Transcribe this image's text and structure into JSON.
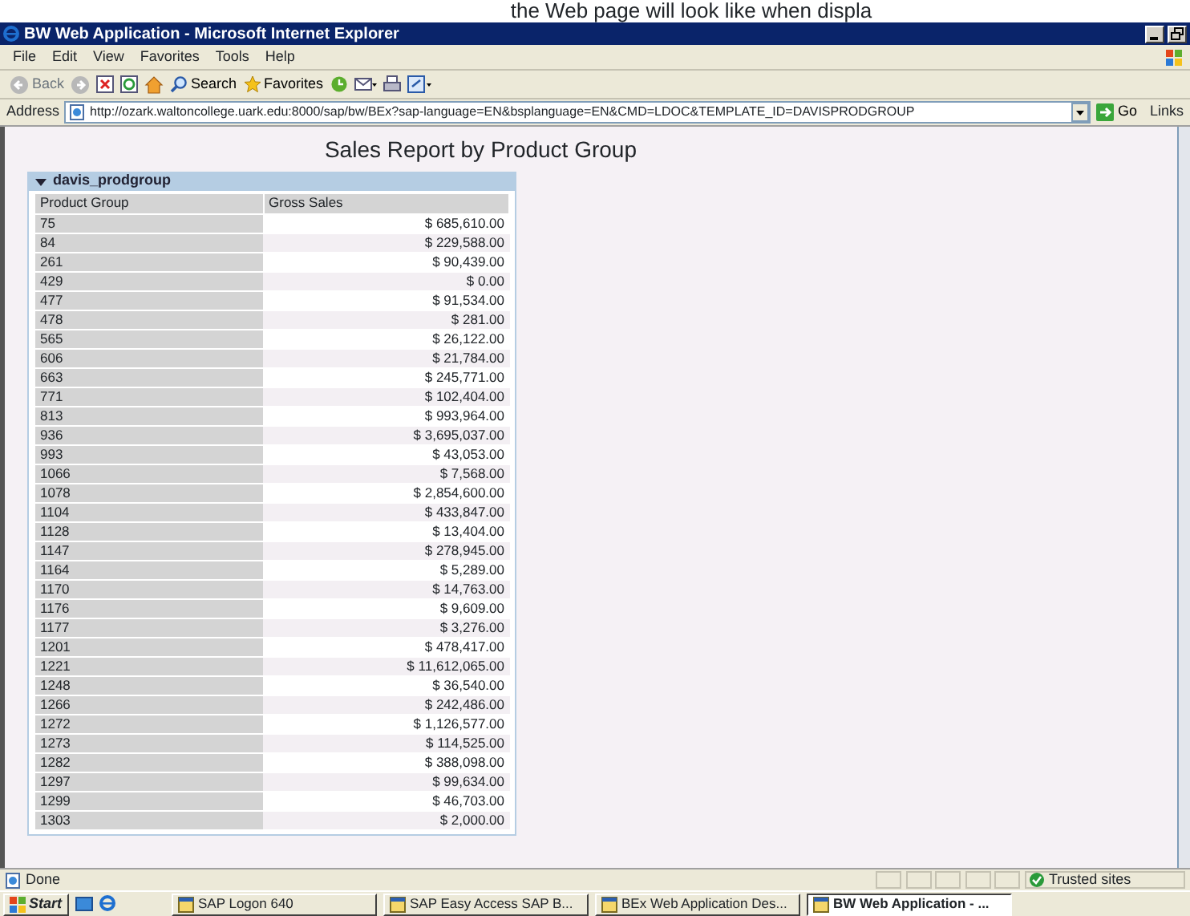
{
  "caption": "the Web page will look like when displa",
  "window": {
    "title": "BW Web Application - Microsoft Internet Explorer"
  },
  "menu": [
    "File",
    "Edit",
    "View",
    "Favorites",
    "Tools",
    "Help"
  ],
  "toolbar": {
    "back": "Back",
    "search": "Search",
    "favorites": "Favorites"
  },
  "address_bar": {
    "label": "Address",
    "url": "http://ozark.waltoncollege.uark.edu:8000/sap/bw/BEx?sap-language=EN&bsplanguage=EN&CMD=LDOC&TEMPLATE_ID=DAVISPRODGROUP",
    "go": "Go",
    "links": "Links"
  },
  "report": {
    "title": "Sales Report by Product Group",
    "group": {
      "name": "davis_prodgroup",
      "expanded": true
    },
    "columns": [
      "Product Group",
      "Gross Sales"
    ],
    "rows": [
      [
        "75",
        "$ 685,610.00"
      ],
      [
        "84",
        "$ 229,588.00"
      ],
      [
        "261",
        "$ 90,439.00"
      ],
      [
        "429",
        "$ 0.00"
      ],
      [
        "477",
        "$ 91,534.00"
      ],
      [
        "478",
        "$ 281.00"
      ],
      [
        "565",
        "$ 26,122.00"
      ],
      [
        "606",
        "$ 21,784.00"
      ],
      [
        "663",
        "$ 245,771.00"
      ],
      [
        "771",
        "$ 102,404.00"
      ],
      [
        "813",
        "$ 993,964.00"
      ],
      [
        "936",
        "$ 3,695,037.00"
      ],
      [
        "993",
        "$ 43,053.00"
      ],
      [
        "1066",
        "$ 7,568.00"
      ],
      [
        "1078",
        "$ 2,854,600.00"
      ],
      [
        "1104",
        "$ 433,847.00"
      ],
      [
        "1128",
        "$ 13,404.00"
      ],
      [
        "1147",
        "$ 278,945.00"
      ],
      [
        "1164",
        "$ 5,289.00"
      ],
      [
        "1170",
        "$ 14,763.00"
      ],
      [
        "1176",
        "$ 9,609.00"
      ],
      [
        "1177",
        "$ 3,276.00"
      ],
      [
        "1201",
        "$ 478,417.00"
      ],
      [
        "1221",
        "$ 11,612,065.00"
      ],
      [
        "1248",
        "$ 36,540.00"
      ],
      [
        "1266",
        "$ 242,486.00"
      ],
      [
        "1272",
        "$ 1,126,577.00"
      ],
      [
        "1273",
        "$ 114,525.00"
      ],
      [
        "1282",
        "$ 388,098.00"
      ],
      [
        "1297",
        "$ 99,634.00"
      ],
      [
        "1299",
        "$ 46,703.00"
      ],
      [
        "1303",
        "$ 2,000.00"
      ]
    ]
  },
  "status_bar": {
    "text": "Done",
    "zone": "Trusted sites"
  },
  "taskbar": {
    "start": "Start",
    "tasks": [
      {
        "label": "SAP Logon 640",
        "selected": false
      },
      {
        "label": "SAP Easy Access  SAP B...",
        "selected": false
      },
      {
        "label": "BEx Web Application Des...",
        "selected": false
      },
      {
        "label": "BW Web Application - ...",
        "selected": true
      }
    ]
  }
}
